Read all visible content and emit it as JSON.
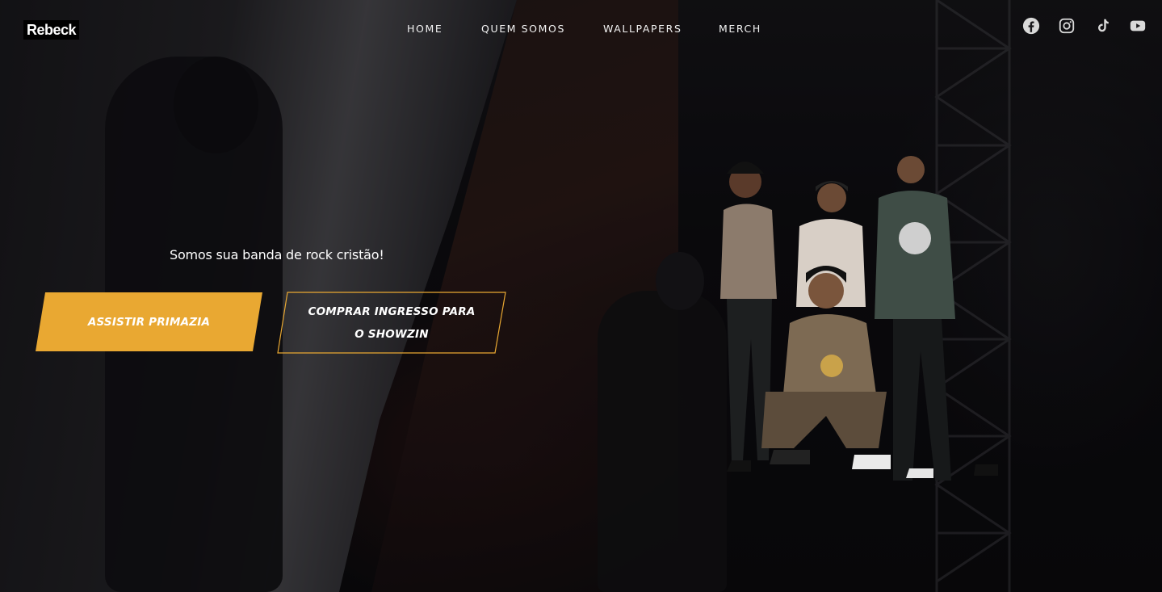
{
  "brand": {
    "logo_text": "Rebeck"
  },
  "nav": {
    "items": [
      {
        "label": "HOME"
      },
      {
        "label": "QUEM SOMOS"
      },
      {
        "label": "WALLPAPERS"
      },
      {
        "label": "MERCH"
      }
    ]
  },
  "socials": {
    "items": [
      {
        "icon": "facebook-icon"
      },
      {
        "icon": "instagram-icon"
      },
      {
        "icon": "tiktok-icon"
      },
      {
        "icon": "youtube-icon"
      }
    ],
    "color": "#d9d9d9"
  },
  "hero": {
    "tagline": "Somos sua banda de rock cristão!",
    "primary_button": "ASSISTIR PRIMAZIA",
    "secondary_button": "COMPRAR INGRESSO PARA O SHOWZIN",
    "accent_color": "#e9a832"
  }
}
